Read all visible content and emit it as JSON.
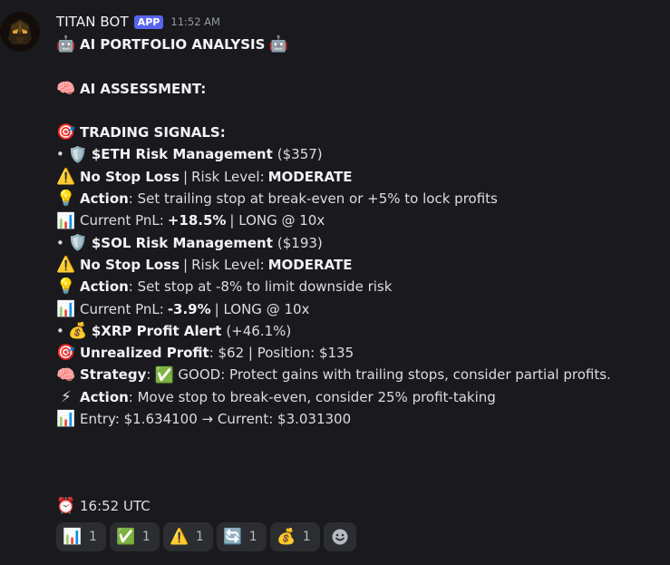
{
  "author": {
    "name": "TITAN BOT",
    "badge": "APP",
    "time": "11:52 AM"
  },
  "content": {
    "title": "AI PORTFOLIO ANALYSIS",
    "assessment": "AI ASSESSMENT:",
    "signals_header": "TRADING SIGNALS:",
    "eth": {
      "title": "$ETH Risk Management",
      "value": "($357)",
      "stop": "No Stop Loss",
      "risk_label": "Risk Level:",
      "risk": "MODERATE",
      "action_label": "Action",
      "action": ": Set trailing stop at break-even or +5% to lock profits",
      "pnl_label": "Current PnL:",
      "pnl": "+18.5%",
      "position": "| LONG @ 10x"
    },
    "sol": {
      "title": "$SOL Risk Management",
      "value": "($193)",
      "stop": "No Stop Loss",
      "risk_label": "Risk Level:",
      "risk": "MODERATE",
      "action_label": "Action",
      "action": ": Set stop at -8% to limit downside risk",
      "pnl_label": "Current PnL:",
      "pnl": "-3.9%",
      "position": "| LONG @ 10x"
    },
    "xrp": {
      "title": "$XRP Profit Alert",
      "value": "(+46.1%)",
      "unrealized_label": "Unrealized Profit",
      "unrealized": ": $62 | Position: $135",
      "strategy_label": "Strategy",
      "strategy": "GOOD: Protect gains with trailing stops, consider partial profits.",
      "action_label": "Action",
      "action": ": Move stop to break-even, consider 25% profit-taking",
      "entry": "Entry: $1.634100 → Current: $3.031300"
    },
    "time_utc": "16:52 UTC"
  },
  "reactions": [
    {
      "icon": "bar-chart-icon",
      "count": "1"
    },
    {
      "icon": "check-mark-icon",
      "count": "1"
    },
    {
      "icon": "warning-icon",
      "count": "1"
    },
    {
      "icon": "repeat-icon",
      "count": "1"
    },
    {
      "icon": "money-bag-icon",
      "count": "1"
    }
  ],
  "colors": {
    "background": "#1a1a1e",
    "badge": "#5865f2",
    "reaction_bg": "#2b2d31"
  }
}
